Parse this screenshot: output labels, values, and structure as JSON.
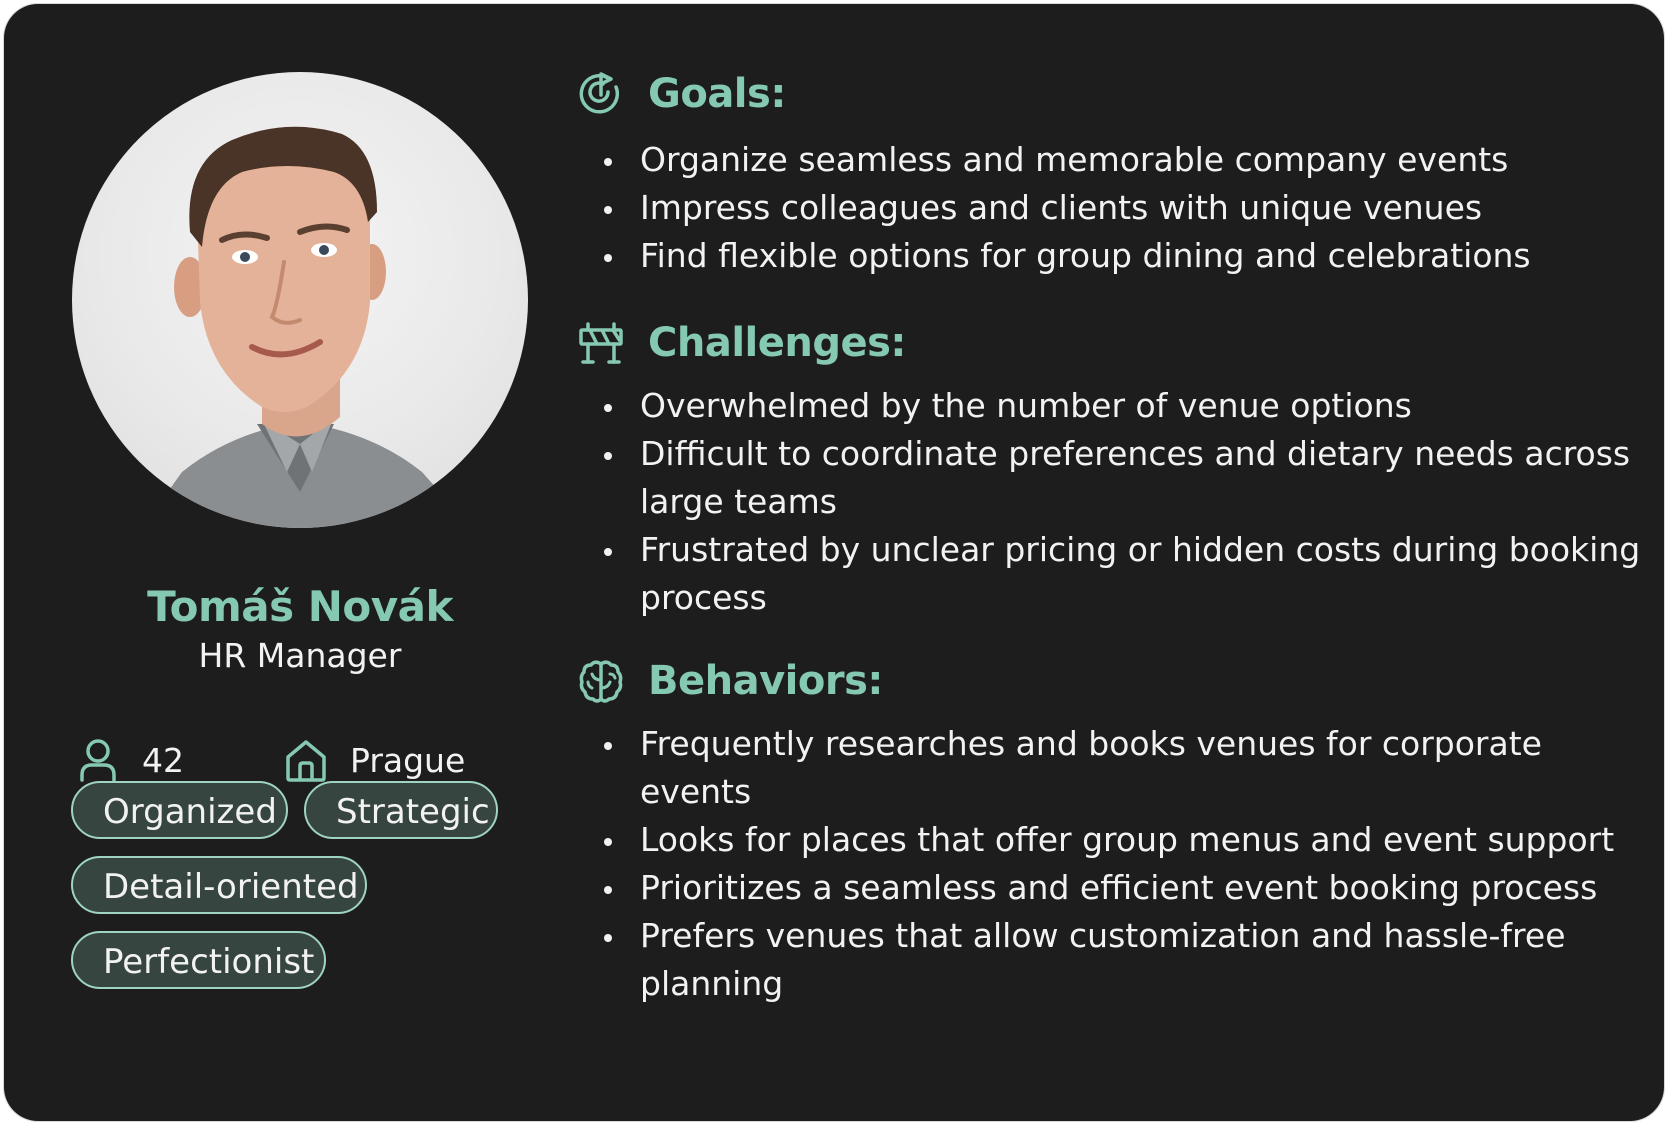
{
  "profile": {
    "name": "Tomáš Novák",
    "role": "HR Manager",
    "age": "42",
    "city": "Prague",
    "photo_alt": "Portrait of Tomáš Novák",
    "tags": [
      "Organized",
      "Strategic",
      "Detail-oriented",
      "Perfectionist"
    ]
  },
  "sections": [
    {
      "icon": "target-icon",
      "title": "Goals:",
      "items": [
        "Organize seamless and memorable company events",
        "Impress colleagues and clients with unique venues",
        "Find flexible options for group dining and celebrations"
      ]
    },
    {
      "icon": "road-barrier-icon",
      "title": "Challenges:",
      "items": [
        "Overwhelmed by the number of venue options",
        "Difficult to coordinate preferences and dietary needs across large teams",
        "Frustrated by unclear pricing or hidden costs during booking process"
      ]
    },
    {
      "icon": "brain-icon",
      "title": "Behaviors:",
      "items": [
        "Frequently researches and books venues for corporate events",
        "Looks for places that offer group menus and event support",
        "Prioritizes a seamless and efficient event booking process",
        "Prefers venues that allow customization and hassle-free planning"
      ]
    }
  ],
  "colors": {
    "background": "#1d1d1e",
    "accent": "#86c9b3",
    "tag_fill": "#364540",
    "tag_border": "#9fd3c2",
    "text": "#f2f2f2"
  }
}
